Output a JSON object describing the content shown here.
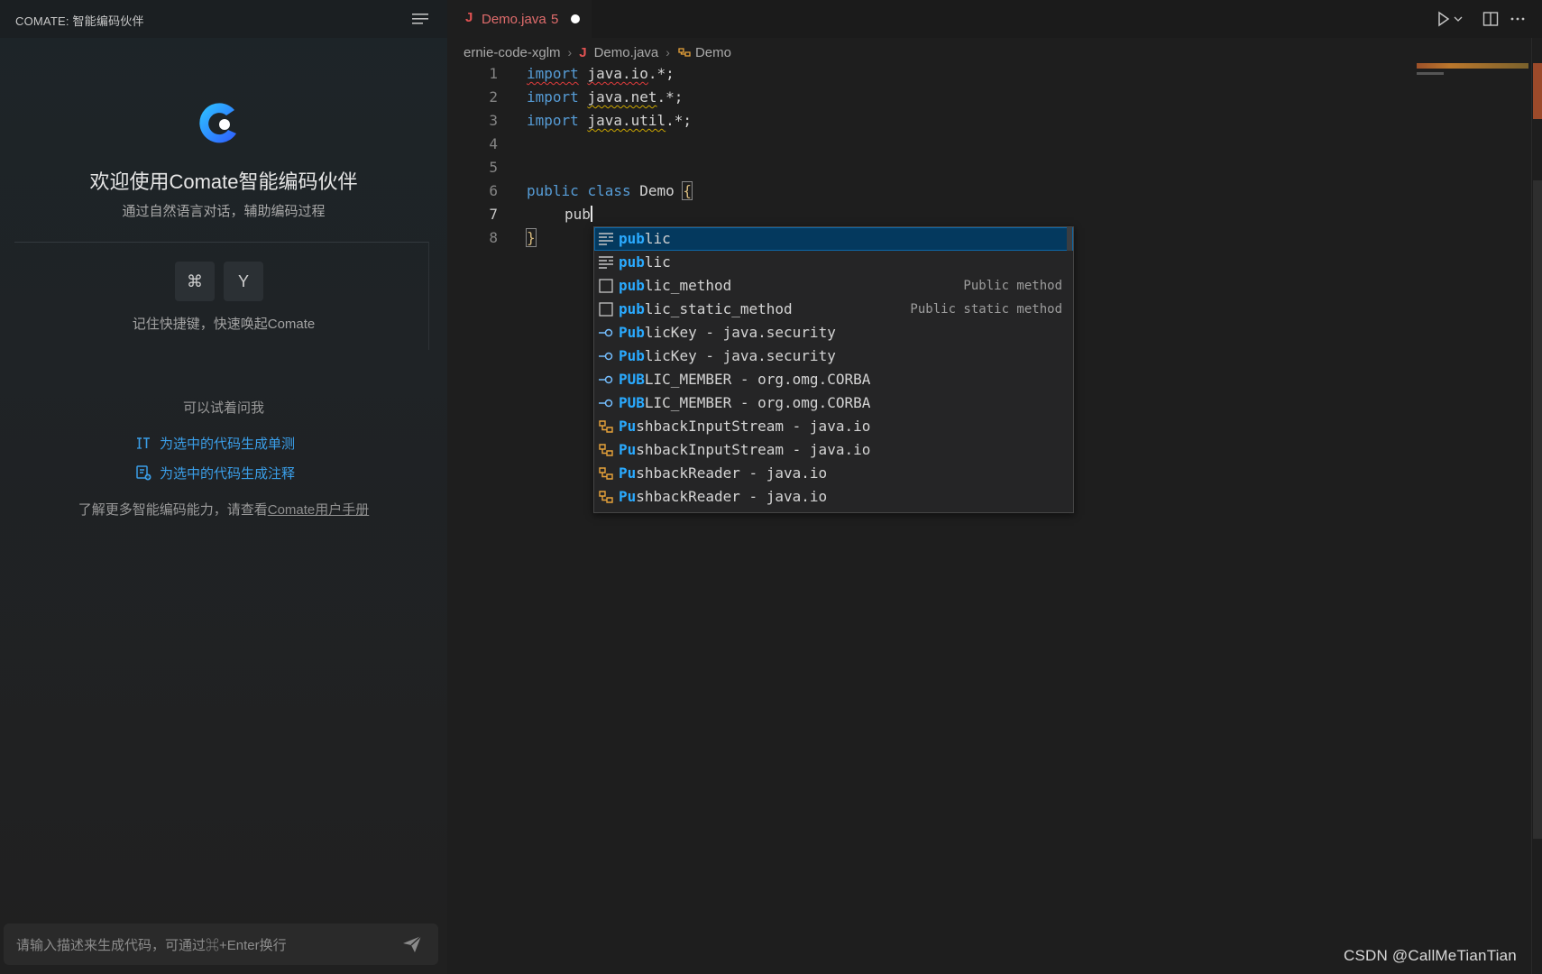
{
  "sidebar": {
    "title": "COMATE: 智能编码伙伴",
    "welcome_title": "欢迎使用Comate智能编码伙伴",
    "welcome_subtitle": "通过自然语言对话，辅助编码过程",
    "shortcut_keys": [
      "⌘",
      "Y"
    ],
    "shortcut_hint": "记住快捷键，快速唤起Comate",
    "try_title": "可以试着问我",
    "suggestions": [
      {
        "icon": "unit-test-icon",
        "label": "为选中的代码生成单测"
      },
      {
        "icon": "add-comment-icon",
        "label": "为选中的代码生成注释"
      }
    ],
    "learn_more_prefix": "了解更多智能编码能力，请查看",
    "learn_more_link": "Comate用户手册",
    "input_placeholder": "请输入描述来生成代码，可通过⌘+Enter换行"
  },
  "editor": {
    "tab": {
      "icon_letter": "J",
      "file_name": "Demo.java",
      "problem_count": "5",
      "modified": true
    },
    "breadcrumb": {
      "folder": "ernie-code-xglm",
      "file_icon": "J",
      "file": "Demo.java",
      "symbol": "Demo"
    },
    "lines": [
      {
        "number": "1",
        "text": "import java.io.*;"
      },
      {
        "number": "2",
        "text": "import java.net.*;"
      },
      {
        "number": "3",
        "text": "import java.util.*;"
      },
      {
        "number": "4",
        "text": ""
      },
      {
        "number": "5",
        "text": ""
      },
      {
        "number": "6",
        "text": "public class Demo {"
      },
      {
        "number": "7",
        "text": "    pub"
      },
      {
        "number": "8",
        "text": "}"
      }
    ],
    "line_parts": {
      "l1_kw": "import",
      "l1_rest": "java.io",
      "l1_tail": ".*;",
      "l2_kw": "import",
      "l2_rest": "java.net",
      "l2_tail": ".*;",
      "l3_kw": "import",
      "l3_rest": "java.util",
      "l3_tail": ".*;",
      "l6_kw1": "public",
      "l6_kw2": "class",
      "l6_name": "Demo",
      "l6_brace": "{",
      "l7_text": "pub",
      "l8_brace": "}"
    },
    "suggest_widget": {
      "items": [
        {
          "icon": "snippet-icon",
          "match": "pub",
          "rest": "lic",
          "detail": "",
          "selected": true
        },
        {
          "icon": "snippet-icon",
          "match": "pub",
          "rest": "lic",
          "detail": ""
        },
        {
          "icon": "method-box-icon",
          "match": "pub",
          "rest": "lic_method",
          "detail": "Public method"
        },
        {
          "icon": "method-box-icon",
          "match": "pub",
          "rest": "lic_static_method",
          "detail": "Public static method"
        },
        {
          "icon": "interface-icon",
          "match": "Pub",
          "rest": "licKey - java.security",
          "detail": ""
        },
        {
          "icon": "interface-icon",
          "match": "Pub",
          "rest": "licKey - java.security",
          "detail": ""
        },
        {
          "icon": "interface-icon",
          "match": "PUB",
          "rest": "LIC_MEMBER - org.omg.CORBA",
          "detail": ""
        },
        {
          "icon": "interface-icon",
          "match": "PUB",
          "rest": "LIC_MEMBER - org.omg.CORBA",
          "detail": ""
        },
        {
          "icon": "class-icon",
          "match": "Pu",
          "rest": "shbackInputStream - java.io",
          "detail": ""
        },
        {
          "icon": "class-icon",
          "match": "Pu",
          "rest": "shbackInputStream - java.io",
          "detail": ""
        },
        {
          "icon": "class-icon",
          "match": "Pu",
          "rest": "shbackReader - java.io",
          "detail": ""
        },
        {
          "icon": "class-icon",
          "match": "Pu",
          "rest": "shbackReader - java.io",
          "detail": ""
        }
      ]
    }
  },
  "watermark": "CSDN @CallMeTianTian",
  "colors": {
    "accent": "#3a9ee8",
    "keyword": "#569cd6",
    "match": "#2aaaff",
    "error_tab": "#e06c6c",
    "selection": "#04395e"
  }
}
